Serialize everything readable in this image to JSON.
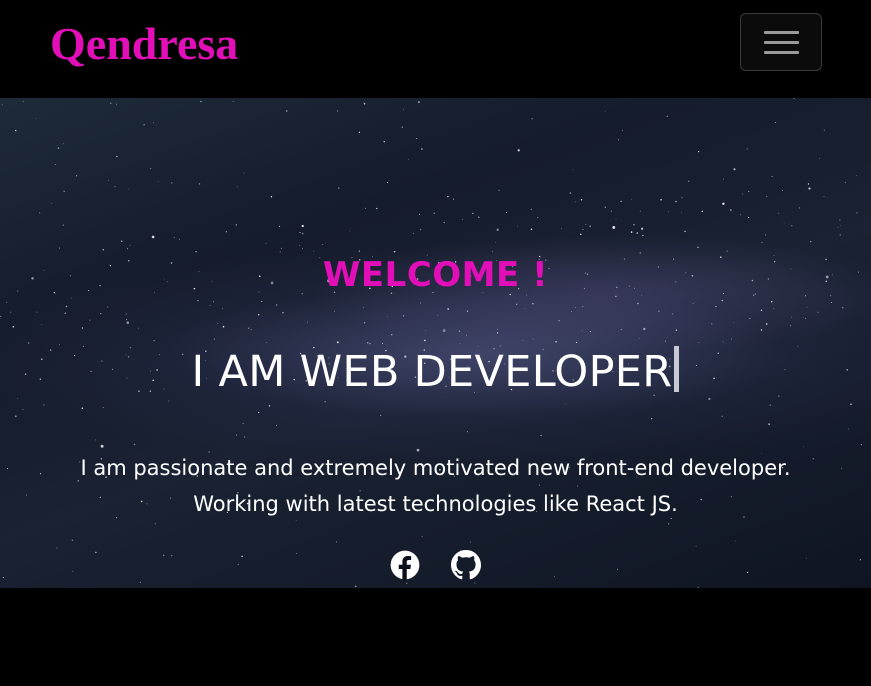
{
  "navbar": {
    "brand": "Qendresa",
    "toggle_icon": "hamburger-menu-icon"
  },
  "hero": {
    "welcome": "WELCOME !",
    "headline": "I AM WEB DEVELOPER",
    "description_line1": "I am passionate and extremely motivated new front-end developer.",
    "description_line2": "Working with latest technologies like React JS.",
    "social": [
      {
        "icon": "facebook-icon"
      },
      {
        "icon": "github-icon"
      }
    ]
  },
  "colors": {
    "accent": "#e20fb8",
    "background": "#000000",
    "text": "#ffffff"
  }
}
